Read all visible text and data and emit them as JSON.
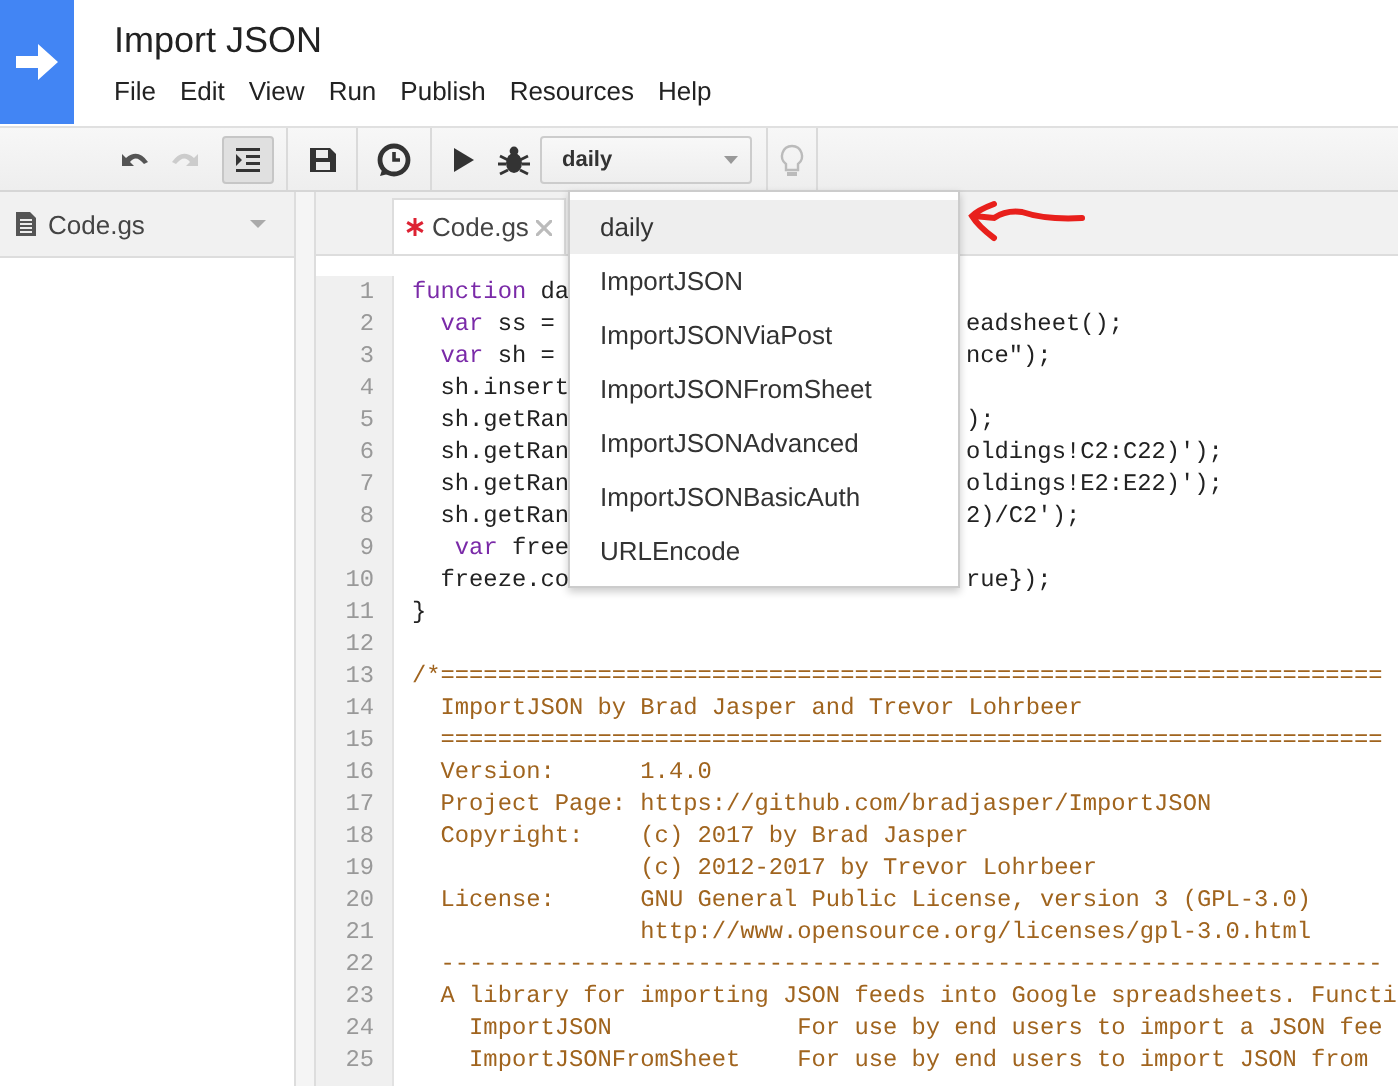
{
  "app": {
    "title": "Import JSON"
  },
  "menu": [
    "File",
    "Edit",
    "View",
    "Run",
    "Publish",
    "Resources",
    "Help"
  ],
  "toolbar": {
    "redo_disabled": true,
    "indent_pressed": true,
    "function_select": "daily",
    "lightbulb_disabled": true
  },
  "sidebar": {
    "file": "Code.gs"
  },
  "tabs": [
    {
      "label": "Code.gs",
      "unsaved": true,
      "selected": true
    }
  ],
  "function_menu": [
    {
      "label": "daily",
      "selected": true
    },
    {
      "label": "ImportJSON",
      "selected": false
    },
    {
      "label": "ImportJSONViaPost",
      "selected": false
    },
    {
      "label": "ImportJSONFromSheet",
      "selected": false
    },
    {
      "label": "ImportJSONAdvanced",
      "selected": false
    },
    {
      "label": "ImportJSONBasicAuth",
      "selected": false
    },
    {
      "label": "URLEncode",
      "selected": false
    }
  ],
  "code_lines": [
    {
      "number": "1",
      "kind": "code",
      "text": "function da"
    },
    {
      "number": "2",
      "kind": "code",
      "text": "  var ss = ",
      "text_right": "eadsheet();"
    },
    {
      "number": "3",
      "kind": "code",
      "text": "  var sh = ",
      "text_right": "nce\");"
    },
    {
      "number": "4",
      "kind": "code",
      "text": "  sh.insert"
    },
    {
      "number": "5",
      "kind": "code",
      "text": "  sh.getRan",
      "text_right": ");"
    },
    {
      "number": "6",
      "kind": "code",
      "text": "  sh.getRan",
      "text_right": "oldings!C2:C22)');"
    },
    {
      "number": "7",
      "kind": "code",
      "text": "  sh.getRan",
      "text_right": "oldings!E2:E22)');"
    },
    {
      "number": "8",
      "kind": "code",
      "text": "  sh.getRan",
      "text_right": "2)/C2');"
    },
    {
      "number": "9",
      "kind": "code",
      "text": "   var free"
    },
    {
      "number": "10",
      "kind": "code",
      "text": "  freeze.co",
      "text_right": "rue});"
    },
    {
      "number": "11",
      "kind": "code",
      "text": "}"
    },
    {
      "number": "12",
      "kind": "code"
    },
    {
      "number": "13",
      "kind": "comment",
      "text": "/*=================================================================="
    },
    {
      "number": "14",
      "kind": "comment",
      "text": "  ImportJSON by Brad Jasper and Trevor Lohrbeer"
    },
    {
      "number": "15",
      "kind": "comment",
      "text": "  =================================================================="
    },
    {
      "number": "16",
      "kind": "comment",
      "text": "  Version:      1.4.0"
    },
    {
      "number": "17",
      "kind": "comment",
      "text": "  Project Page: https://github.com/bradjasper/ImportJSON"
    },
    {
      "number": "18",
      "kind": "comment",
      "text": "  Copyright:    (c) 2017 by Brad Jasper"
    },
    {
      "number": "19",
      "kind": "comment",
      "text": "                (c) 2012-2017 by Trevor Lohrbeer"
    },
    {
      "number": "20",
      "kind": "comment",
      "text": "  License:      GNU General Public License, version 3 (GPL-3.0)"
    },
    {
      "number": "21",
      "kind": "comment",
      "text": "                http://www.opensource.org/licenses/gpl-3.0.html"
    },
    {
      "number": "22",
      "kind": "comment",
      "text": "  ------------------------------------------------------------------"
    },
    {
      "number": "23",
      "kind": "comment",
      "text": "  A library for importing JSON feeds into Google spreadsheets. Functi"
    },
    {
      "number": "24",
      "kind": "comment",
      "text": "    ImportJSON             For use by end users to import a JSON fee"
    },
    {
      "number": "25",
      "kind": "comment",
      "text": "    ImportJSONFromSheet    For use by end users to import JSON from"
    }
  ]
}
